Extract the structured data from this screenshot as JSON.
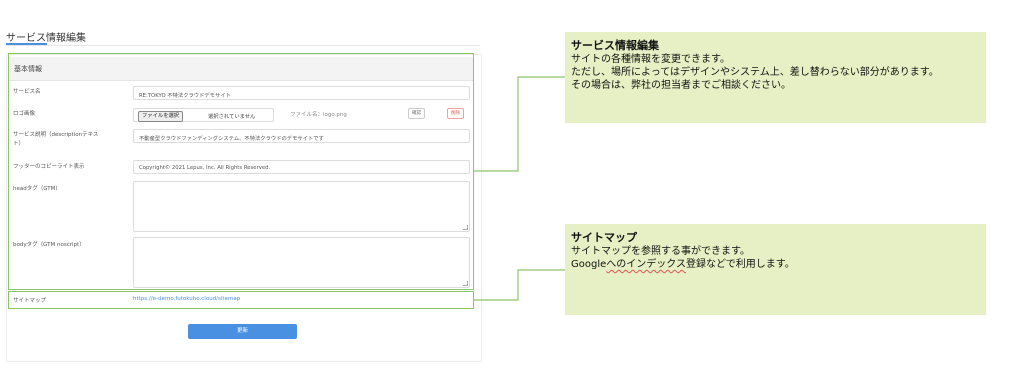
{
  "page": {
    "tab_title": "サービス情報編集"
  },
  "form": {
    "section_title": "基本情報",
    "service_name": {
      "label": "サービス名",
      "value": "RE:TOKYO 不特法クラウドデモサイト"
    },
    "logo": {
      "label": "ロゴ画像",
      "file_button": "ファイルを選択",
      "file_status": "選択されていません",
      "filename": "ファイル名：logo.png",
      "confirm_label": "確認",
      "delete_label": "削除"
    },
    "description": {
      "label_line1": "サービス説明（descriptionテキス",
      "label_line2": "ト）",
      "value": "不動産型クラウドファンディングシステム、不特法クラウドのデモサイトです"
    },
    "footer_copyright": {
      "label": "フッターのコピーライト表示",
      "value": "Copyright© 2021 Lepus, Inc. All Rights Reserved."
    },
    "head_tag": {
      "label": "headタグ（GTM）",
      "value": ""
    },
    "body_tag": {
      "label": "bodyタグ（GTM noscript）",
      "value": ""
    },
    "sitemap": {
      "label": "サイトマップ",
      "url": "https://e-demo.futokuho.cloud/sitemap"
    },
    "update_button": "更新"
  },
  "notes": {
    "service_edit": {
      "title": "サービス情報編集",
      "lines": [
        "サイトの各種情報を変更できます。",
        "ただし、場所によってはデザインやシステム上、差し替わらない部分があります。",
        "その場合は、弊社の担当者までご相談ください。"
      ]
    },
    "sitemap": {
      "title": "サイトマップ",
      "line1": "サイトマップを参照する事ができます。",
      "line2_plain": "Google",
      "line2_squiggle": "へのインデックス",
      "line2_rest": "登録などで利用します。"
    }
  },
  "colors": {
    "accent": "#4a90e2",
    "annotation_border": "#8cc46a",
    "note_background": "#e6f0c4",
    "delete": "#e05555"
  }
}
